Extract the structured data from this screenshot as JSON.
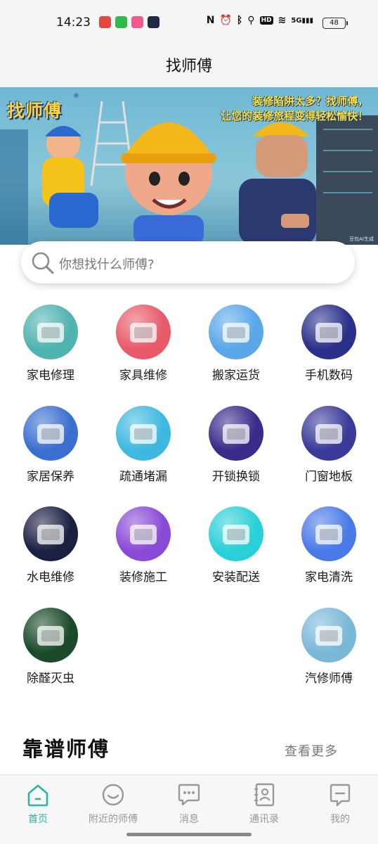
{
  "status_bar": {
    "time": "14:23",
    "signal_label": "5G",
    "hd_label": "HD",
    "battery": "48",
    "left_app_icons": [
      "red-app-icon",
      "green-message-icon",
      "pink-app-icon",
      "dark-clock-app-icon"
    ],
    "right_icons": [
      "nfc-icon",
      "alarm-icon",
      "bluetooth-icon",
      "location-icon",
      "hd-icon",
      "wifi-icon",
      "signal-icon",
      "battery-icon"
    ]
  },
  "header": {
    "title": "找师傅"
  },
  "banner": {
    "logo": "找师傅",
    "logo_mark": "®",
    "slogan_line1": "装修陷阱太多？找师傅，",
    "slogan_line2": "让您的装修旅程变得轻松愉快！",
    "credit": "豆包AI生成"
  },
  "search": {
    "placeholder": "你想找什么师傅?"
  },
  "categories": [
    {
      "label": "家电修理",
      "icon": "air-conditioner-icon",
      "color": "#4fb3b0"
    },
    {
      "label": "家具维修",
      "icon": "sofa-icon",
      "color": "#e85a6a"
    },
    {
      "label": "搬家运货",
      "icon": "truck-icon",
      "color": "#5aa6e8"
    },
    {
      "label": "手机数码",
      "icon": "laptop-icon",
      "color": "#2a2f8a"
    },
    {
      "label": "家居保养",
      "icon": "house-room-icon",
      "color": "#3a6fd0"
    },
    {
      "label": "疏通堵漏",
      "icon": "pipe-water-icon",
      "color": "#3fb8e0"
    },
    {
      "label": "开锁换锁",
      "icon": "padlock-icon",
      "color": "#3a2a8a"
    },
    {
      "label": "门窗地板",
      "icon": "door-icon",
      "color": "#3a3a9a"
    },
    {
      "label": "水电维修",
      "icon": "water-drop-bolt-icon",
      "color": "#1a2040"
    },
    {
      "label": "装修施工",
      "icon": "building-house-icon",
      "color": "#8a4ad8"
    },
    {
      "label": "安装配送",
      "icon": "monitor-icon",
      "color": "#2ad0d8"
    },
    {
      "label": "家电清洗",
      "icon": "fridge-icon",
      "color": "#4a7ae8"
    },
    {
      "label": "除醛灭虫",
      "icon": "leaf-icon",
      "color": "#1a4a2a"
    },
    {
      "label": "汽修师傅",
      "icon": "car-repair-icon",
      "color": "#7ab8d8"
    }
  ],
  "section": {
    "title": "靠谱师傅",
    "more": "查看更多"
  },
  "nav": [
    {
      "label": "首页",
      "icon": "home-icon",
      "active": true
    },
    {
      "label": "附近的师傅",
      "icon": "smiley-icon",
      "active": false
    },
    {
      "label": "消息",
      "icon": "chat-bubble-icon",
      "active": false
    },
    {
      "label": "通讯录",
      "icon": "contacts-icon",
      "active": false
    },
    {
      "label": "我的",
      "icon": "profile-message-icon",
      "active": false
    }
  ],
  "colors": {
    "accent": "#2bb3a3",
    "inactive": "#999999"
  }
}
